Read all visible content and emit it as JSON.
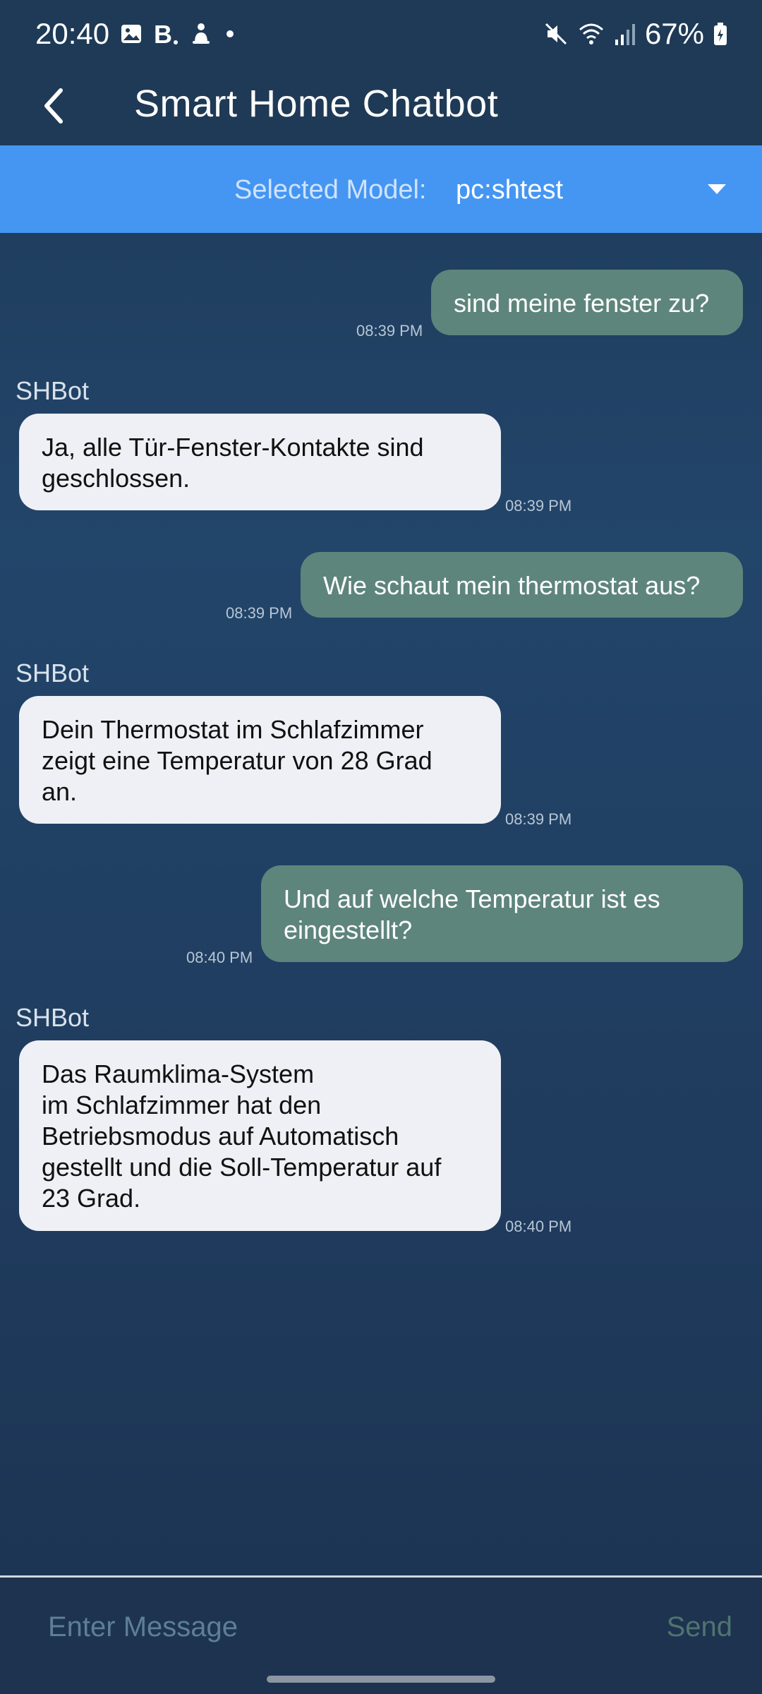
{
  "status_bar": {
    "time": "20:40",
    "battery": "67%",
    "left_icons": [
      "image-icon",
      "b-app-icon",
      "notification-icon",
      "dot-icon"
    ],
    "right_icons": [
      "mute-icon",
      "wifi-icon",
      "signal-icon",
      "battery-icon"
    ]
  },
  "app_bar": {
    "title": "Smart Home Chatbot",
    "back_icon": "back-arrow-icon"
  },
  "model_selector": {
    "label": "Selected Model:",
    "value": "pc:shtest",
    "dropdown_icon": "caret-down-icon"
  },
  "messages": [
    {
      "sender": "user",
      "text": "sind meine fenster zu?",
      "time": "08:39 PM"
    },
    {
      "sender": "SHBot",
      "text": "Ja, alle Tür-Fenster-Kontakte sind\ngeschlossen.",
      "time": "08:39 PM"
    },
    {
      "sender": "user",
      "text": "Wie schaut mein thermostat aus?",
      "time": "08:39 PM"
    },
    {
      "sender": "SHBot",
      "text": "Dein Thermostat im Schlafzimmer\nzeigt eine Temperatur von 28 Grad\nan.",
      "time": "08:39 PM"
    },
    {
      "sender": "user",
      "text": "Und auf welche Temperatur ist es\neingestellt?",
      "time": "08:40 PM"
    },
    {
      "sender": "SHBot",
      "text": "Das Raumklima-System\nim Schlafzimmer hat den\nBetriebsmodus auf Automatisch\ngestellt und die Soll-Temperatur auf\n23 Grad.",
      "time": "08:40 PM"
    }
  ],
  "input": {
    "placeholder": "Enter Message",
    "value": "",
    "send_label": "Send"
  },
  "colors": {
    "header": "#1e3a56",
    "model_bar": "#4596f2",
    "user_bubble": "#5e857b",
    "bot_bubble": "#eff0f6",
    "send_text": "#4f7470"
  }
}
